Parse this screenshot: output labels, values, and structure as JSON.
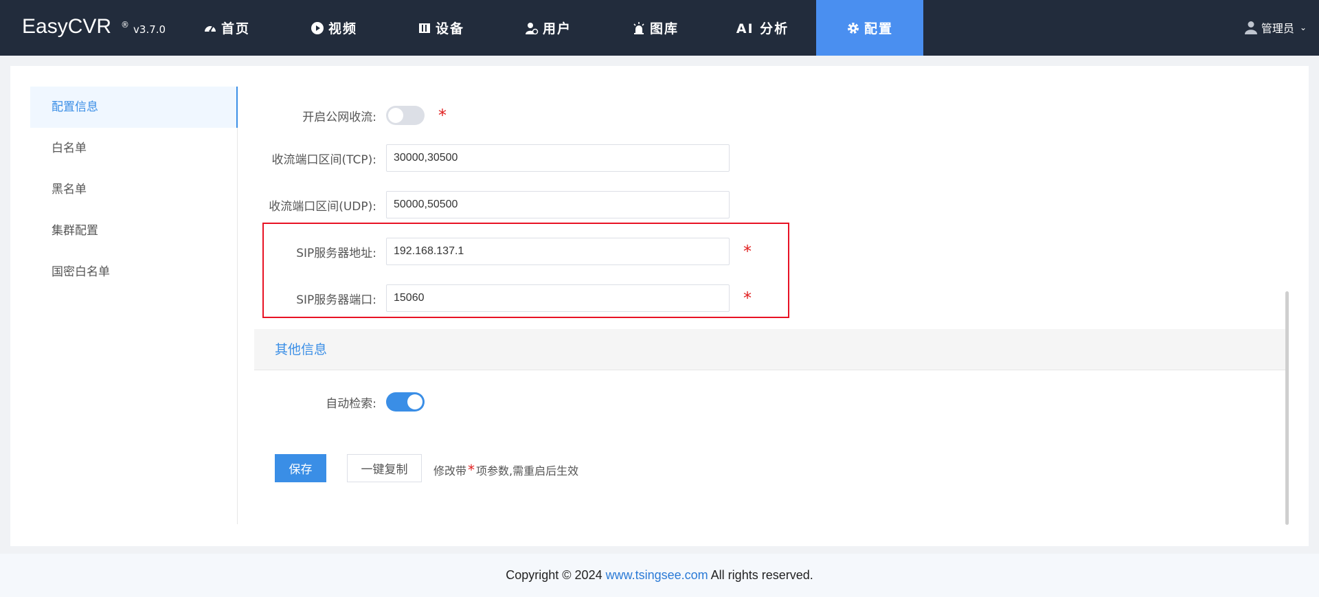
{
  "app": {
    "name": "EasyCVR",
    "reg": "®",
    "version": "v3.7.0"
  },
  "nav": [
    {
      "label": "首页",
      "icon": "dashboard-icon"
    },
    {
      "label": "视频",
      "icon": "play-icon"
    },
    {
      "label": "设备",
      "icon": "device-icon"
    },
    {
      "label": "用户",
      "icon": "user-gear-icon"
    },
    {
      "label": "图库",
      "icon": "alarm-icon"
    },
    {
      "label": "AI 分析",
      "icon": ""
    },
    {
      "label": "配置",
      "icon": "gear-icon",
      "active": true
    }
  ],
  "user": {
    "name": "管理员"
  },
  "sidebar": {
    "items": [
      {
        "label": "配置信息",
        "active": true
      },
      {
        "label": "白名单"
      },
      {
        "label": "黑名单"
      },
      {
        "label": "集群配置"
      },
      {
        "label": "国密白名单"
      }
    ]
  },
  "form": {
    "public_stream": {
      "label": "开启公网收流:",
      "enabled": false
    },
    "tcp_range": {
      "label": "收流端口区间(TCP):",
      "value": "30000,30500"
    },
    "udp_range": {
      "label": "收流端口区间(UDP):",
      "value": "50000,50500"
    },
    "sip_addr": {
      "label": "SIP服务器地址:",
      "value": "192.168.137.1"
    },
    "sip_port": {
      "label": "SIP服务器端口:",
      "value": "15060"
    }
  },
  "other": {
    "title": "其他信息",
    "auto_search": {
      "label": "自动检索:",
      "enabled": true
    }
  },
  "actions": {
    "save_label": "保存",
    "copy_label": "一键复制",
    "hint_before": "修改带",
    "hint_star": "*",
    "hint_after": "项参数,需重启后生效"
  },
  "footer": {
    "prefix": "Copyright © 2024 ",
    "link": "www.tsingsee.com",
    "suffix": " All rights reserved."
  },
  "colors": {
    "header_bg": "#222c3c",
    "accent": "#3a8ee6",
    "required": "#e02020",
    "highlight": "#e81123"
  }
}
